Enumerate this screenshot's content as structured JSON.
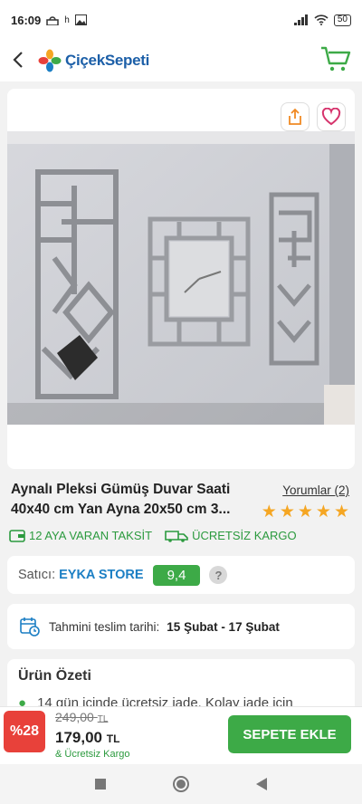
{
  "status_bar": {
    "time": "16:09",
    "battery": "50",
    "icons": [
      "mosque-icon",
      "notification-icon",
      "image-icon",
      "signal-icon",
      "wifi-icon",
      "battery-icon"
    ],
    "extra": "h"
  },
  "app_bar": {
    "logo_text": "ÇiçekSepeti",
    "back_icon": "back-arrow-icon",
    "cart_icon": "cart-icon"
  },
  "product": {
    "title": "Aynalı Pleksi Gümüş Duvar Saati 40x40 cm Yan Ayna 20x50 cm 3...",
    "reviews_label": "Yorumlar (2)",
    "rating_stars": 5,
    "badges": [
      "12 AYA VARAN TAKSİT",
      "ÜCRETSİZ KARGO"
    ]
  },
  "seller": {
    "label": "Satıcı:",
    "name": "EYKA STORE",
    "score": "9,4",
    "help": "?"
  },
  "delivery": {
    "label": "Tahmini teslim tarihi:",
    "value": "15 Şubat - 17 Şubat"
  },
  "summary": {
    "title": "Ürün Özeti",
    "first_item": "14 gün içinde ücretsiz iade. Kolay iade için"
  },
  "price_bar": {
    "discount": "%28",
    "old_price": "249,00",
    "old_currency": "TL",
    "new_price": "179,00",
    "new_currency": "TL",
    "cargo_note": "& Ücretsiz Kargo",
    "add_to_cart": "SEPETE EKLE"
  },
  "colors": {
    "brand_blue": "#1c5fa8",
    "green": "#3daa47",
    "discount_red": "#e8413a",
    "star": "#f5a623"
  }
}
